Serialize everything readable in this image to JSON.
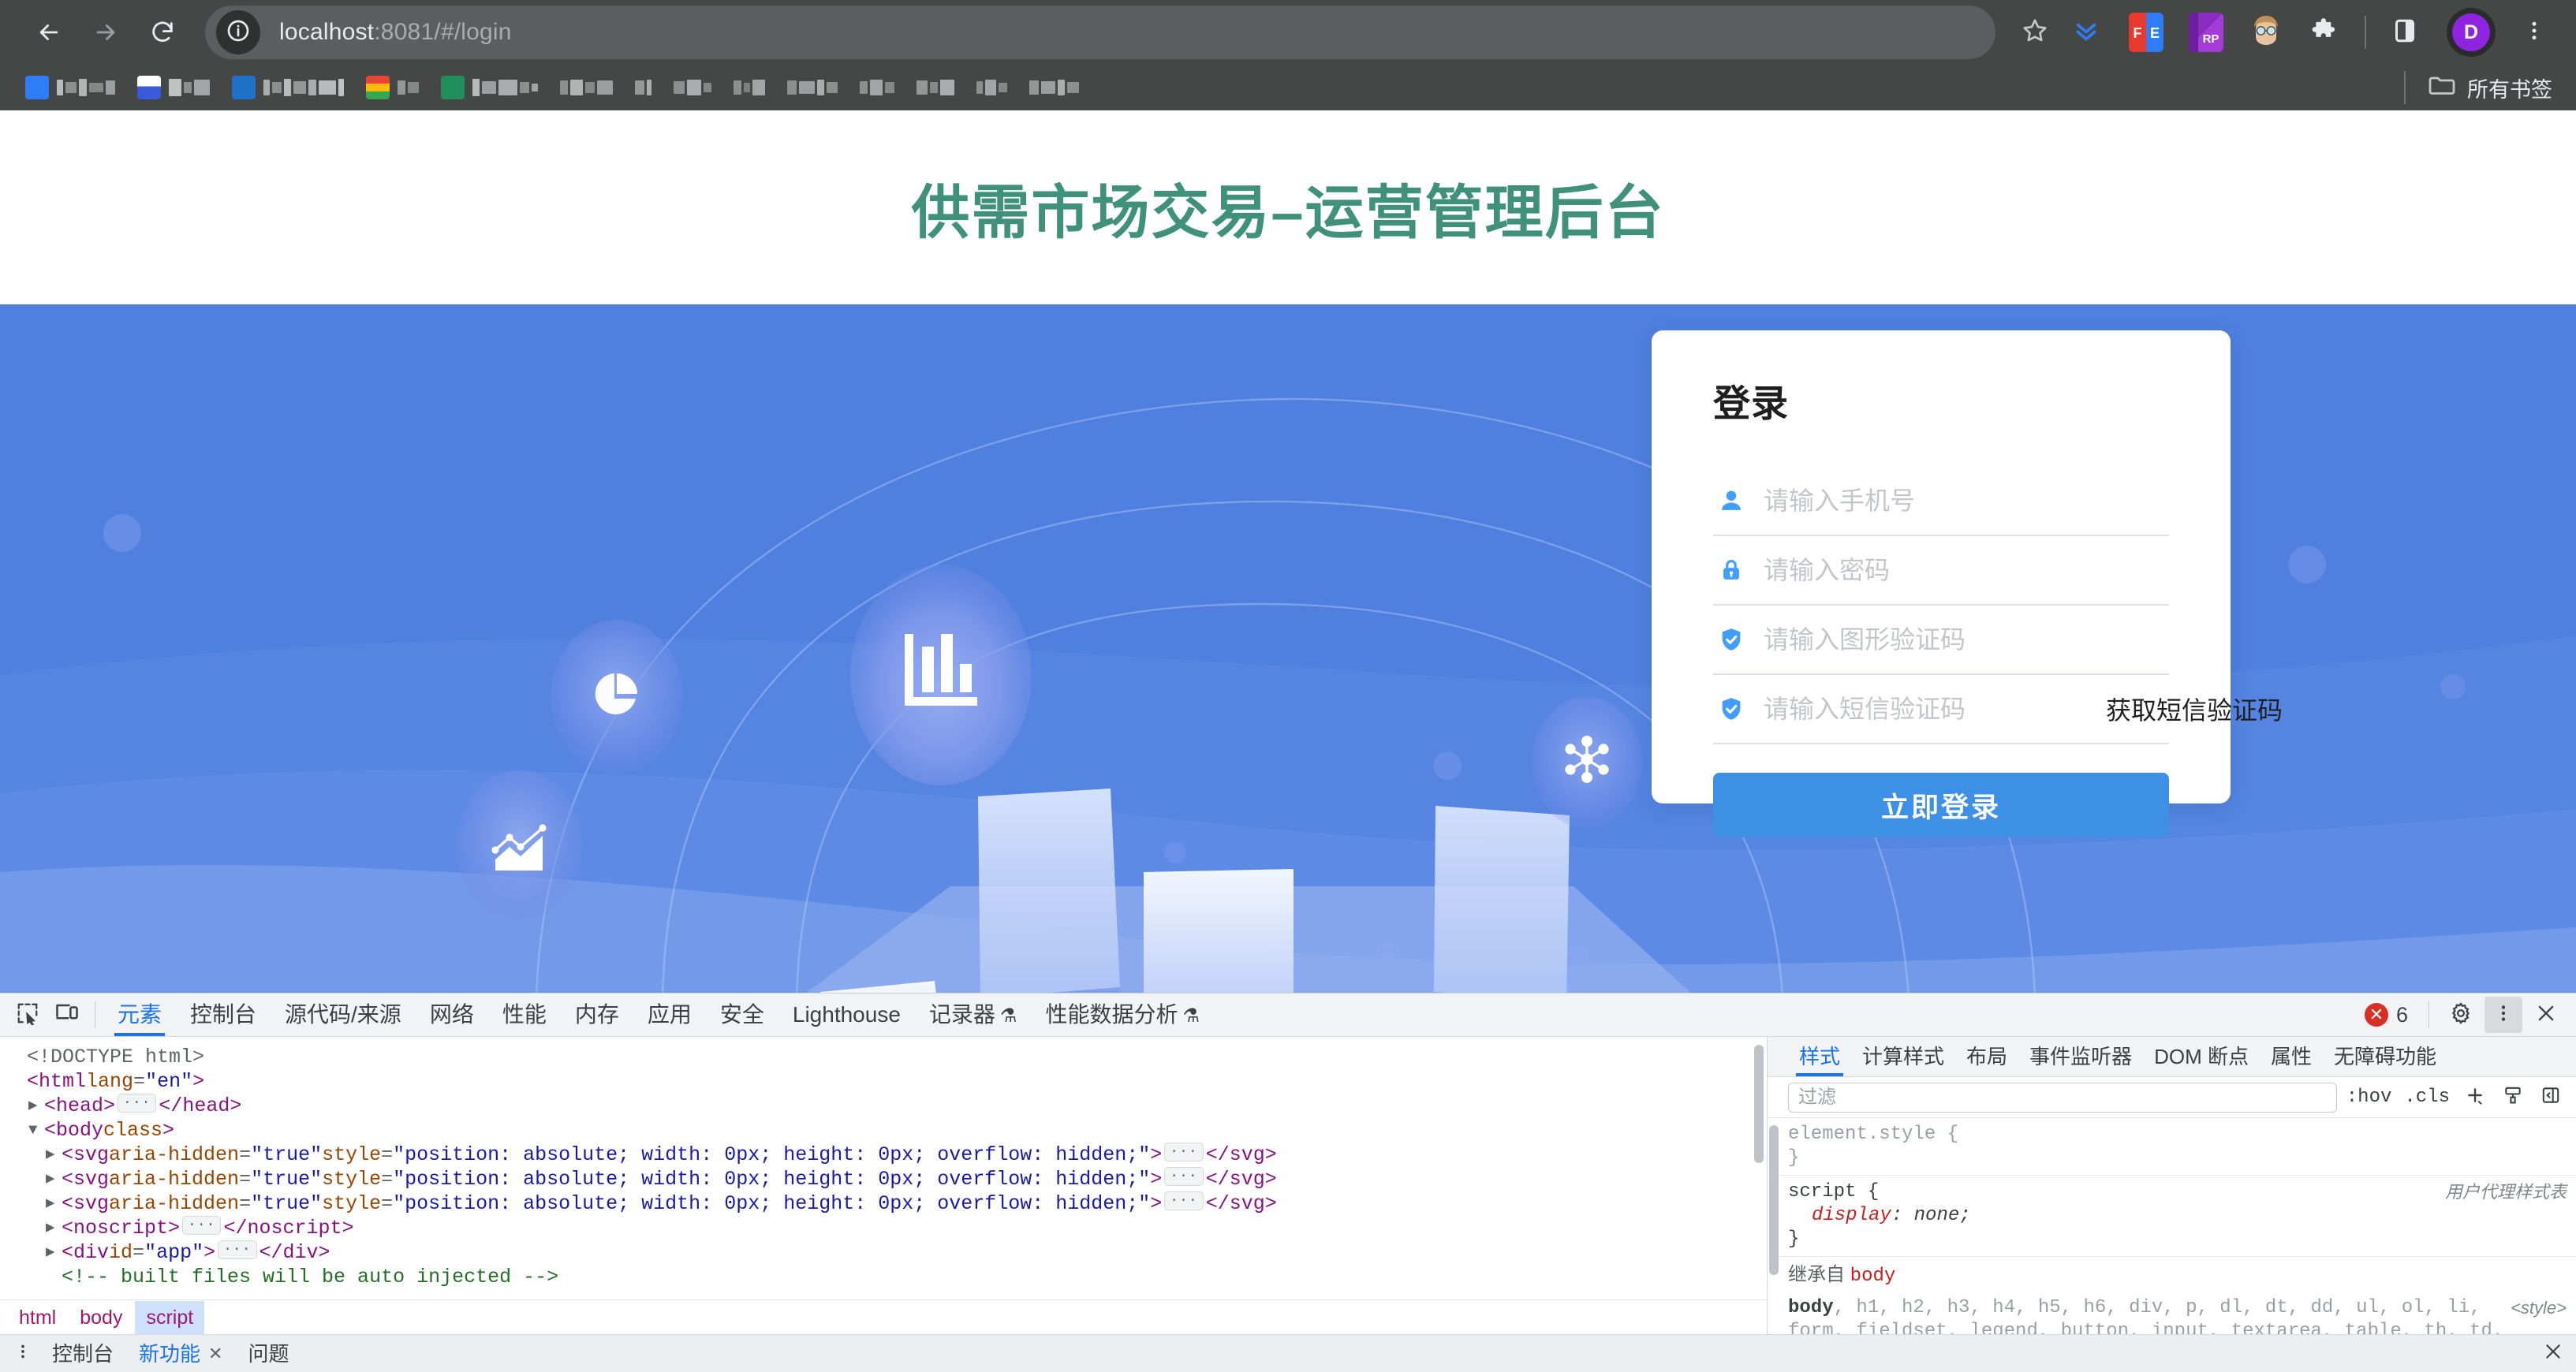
{
  "browser": {
    "url_main": "localhost",
    "url_rest": ":8081/#/login",
    "back_icon": "arrow-left-icon",
    "forward_icon": "arrow-right-icon",
    "reload_icon": "reload-icon",
    "site_info_icon": "info-circle-icon",
    "bookmark_star_icon": "star-icon",
    "downloads_icon": "downloads-icon",
    "extension_fe": "FE",
    "extension_rp": "RP",
    "profile_initial": "D",
    "menu_icon": "kebab-menu-icon",
    "all_bookmarks_label": "所有书签",
    "bookmarks_folder_icon": "folder-icon"
  },
  "page": {
    "title": "供需市场交易–运营管理后台",
    "title_color": "#3f9279",
    "hero_color": "#4f7fdf",
    "illustration_icons": [
      "pie-chart-icon",
      "bar-chart-icon",
      "network-hub-icon",
      "line-chart-icon"
    ]
  },
  "login": {
    "heading": "登录",
    "fields": [
      {
        "icon": "user-icon",
        "placeholder": "请输入手机号",
        "value": ""
      },
      {
        "icon": "lock-icon",
        "placeholder": "请输入密码",
        "value": ""
      },
      {
        "icon": "shield-check-icon",
        "placeholder": "请输入图形验证码",
        "value": ""
      },
      {
        "icon": "shield-check-icon",
        "placeholder": "请输入短信验证码",
        "value": ""
      }
    ],
    "sms_button": "获取短信验证码",
    "submit_button": "立即登录",
    "submit_color": "#3d90e3",
    "icon_color": "#409eff"
  },
  "devtools": {
    "inspect_icon": "inspect-element-icon",
    "device_icon": "device-toolbar-icon",
    "tabs": [
      {
        "label": "元素",
        "active": true
      },
      {
        "label": "控制台",
        "active": false
      },
      {
        "label": "源代码/来源",
        "active": false
      },
      {
        "label": "网络",
        "active": false
      },
      {
        "label": "性能",
        "active": false
      },
      {
        "label": "内存",
        "active": false
      },
      {
        "label": "应用",
        "active": false
      },
      {
        "label": "安全",
        "active": false
      },
      {
        "label": "Lighthouse",
        "active": false
      },
      {
        "label": "记录器",
        "active": false,
        "flask": "⚗"
      },
      {
        "label": "性能数据分析",
        "active": false,
        "flask": "⚗"
      }
    ],
    "error_count": "6",
    "error_icon": "error-circle-icon",
    "settings_icon": "gear-icon",
    "more_icon": "kebab-menu-icon",
    "close_icon": "close-icon",
    "dom": [
      {
        "indent": 0,
        "tri": "none",
        "parts": [
          {
            "t": "<!DOCTYPE html>",
            "c": "dt-gray"
          }
        ]
      },
      {
        "indent": 0,
        "tri": "none",
        "parts": [
          {
            "t": "<",
            "c": "tg"
          },
          {
            "t": "html",
            "c": "tg"
          },
          {
            "t": " lang",
            "c": "at"
          },
          {
            "t": "=",
            "c": "dt-gray"
          },
          {
            "t": "\"en\"",
            "c": "av"
          },
          {
            "t": ">",
            "c": "tg"
          }
        ]
      },
      {
        "indent": 1,
        "tri": "closed",
        "parts": [
          {
            "t": "<head>",
            "c": "tg"
          },
          {
            "t": "…",
            "c": "ellipsis"
          },
          {
            "t": "</head>",
            "c": "tg"
          }
        ]
      },
      {
        "indent": 1,
        "tri": "open",
        "parts": [
          {
            "t": "<",
            "c": "tg"
          },
          {
            "t": "body",
            "c": "tg"
          },
          {
            "t": " class",
            "c": "at"
          },
          {
            "t": ">",
            "c": "tg"
          }
        ]
      },
      {
        "indent": 2,
        "tri": "closed",
        "parts": [
          {
            "t": "<",
            "c": "tg"
          },
          {
            "t": "svg",
            "c": "tg"
          },
          {
            "t": " aria-hidden",
            "c": "at"
          },
          {
            "t": "=",
            "c": "dt-gray"
          },
          {
            "t": "\"true\"",
            "c": "av"
          },
          {
            "t": " style",
            "c": "at"
          },
          {
            "t": "=",
            "c": "dt-gray"
          },
          {
            "t": "\"position: absolute; width: 0px; height: 0px; overflow: hidden;\"",
            "c": "av"
          },
          {
            "t": ">",
            "c": "tg"
          },
          {
            "t": "…",
            "c": "ellipsis"
          },
          {
            "t": "</svg>",
            "c": "tg"
          }
        ]
      },
      {
        "indent": 2,
        "tri": "closed",
        "parts": [
          {
            "t": "<",
            "c": "tg"
          },
          {
            "t": "svg",
            "c": "tg"
          },
          {
            "t": " aria-hidden",
            "c": "at"
          },
          {
            "t": "=",
            "c": "dt-gray"
          },
          {
            "t": "\"true\"",
            "c": "av"
          },
          {
            "t": " style",
            "c": "at"
          },
          {
            "t": "=",
            "c": "dt-gray"
          },
          {
            "t": "\"position: absolute; width: 0px; height: 0px; overflow: hidden;\"",
            "c": "av"
          },
          {
            "t": ">",
            "c": "tg"
          },
          {
            "t": "…",
            "c": "ellipsis"
          },
          {
            "t": "</svg>",
            "c": "tg"
          }
        ]
      },
      {
        "indent": 2,
        "tri": "closed",
        "parts": [
          {
            "t": "<",
            "c": "tg"
          },
          {
            "t": "svg",
            "c": "tg"
          },
          {
            "t": " aria-hidden",
            "c": "at"
          },
          {
            "t": "=",
            "c": "dt-gray"
          },
          {
            "t": "\"true\"",
            "c": "av"
          },
          {
            "t": " style",
            "c": "at"
          },
          {
            "t": "=",
            "c": "dt-gray"
          },
          {
            "t": "\"position: absolute; width: 0px; height: 0px; overflow: hidden;\"",
            "c": "av"
          },
          {
            "t": ">",
            "c": "tg"
          },
          {
            "t": "…",
            "c": "ellipsis"
          },
          {
            "t": "</svg>",
            "c": "tg"
          }
        ]
      },
      {
        "indent": 2,
        "tri": "closed",
        "parts": [
          {
            "t": "<noscript>",
            "c": "tg"
          },
          {
            "t": "…",
            "c": "ellipsis"
          },
          {
            "t": "</noscript>",
            "c": "tg"
          }
        ]
      },
      {
        "indent": 2,
        "tri": "closed",
        "parts": [
          {
            "t": "<",
            "c": "tg"
          },
          {
            "t": "div",
            "c": "tg"
          },
          {
            "t": " id",
            "c": "at"
          },
          {
            "t": "=",
            "c": "dt-gray"
          },
          {
            "t": "\"app\"",
            "c": "av"
          },
          {
            "t": ">",
            "c": "tg"
          },
          {
            "t": "…",
            "c": "ellipsis"
          },
          {
            "t": "</div>",
            "c": "tg"
          }
        ]
      },
      {
        "indent": 2,
        "tri": "none",
        "parts": [
          {
            "t": "<!-- built files will be auto injected -->",
            "c": "cm"
          }
        ]
      }
    ],
    "breadcrumbs": [
      {
        "label": "html",
        "active": false
      },
      {
        "label": "body",
        "active": false
      },
      {
        "label": "script",
        "active": true
      }
    ],
    "styles": {
      "tabs": [
        {
          "label": "样式",
          "active": true
        },
        {
          "label": "计算样式",
          "active": false
        },
        {
          "label": "布局",
          "active": false
        },
        {
          "label": "事件监听器",
          "active": false
        },
        {
          "label": "DOM 断点",
          "active": false
        },
        {
          "label": "属性",
          "active": false
        },
        {
          "label": "无障碍功能",
          "active": false
        }
      ],
      "filter_placeholder": "过滤",
      "filter_value": "",
      "hov_label": ":hov",
      "cls_label": ".cls",
      "add_icon": "plus-icon",
      "pen_icon": "style-pen-icon",
      "sidebar_icon": "toggle-sidebar-icon",
      "rules": [
        {
          "selector": "element.style {",
          "close": "}",
          "origin": "",
          "decls": []
        },
        {
          "selector": "script {",
          "close": "}",
          "origin": "用户代理样式表",
          "decls": [
            {
              "prop": "display",
              "value": "none;"
            }
          ]
        }
      ],
      "inherit_label": "继承自",
      "inherit_from": "body",
      "inherited_rule_bold": "body",
      "inherited_rule_rest": ", h1, h2, h3, h4, h5, h6, div, p, dl, dt, dd, ul, ol, li,",
      "inherited_rule_line2": "form, fieldset, legend, button, input, textarea, table, th, td,",
      "inherited_origin": "<style>"
    },
    "drawer": {
      "kebab_icon": "kebab-menu-icon",
      "tabs": [
        {
          "label": "控制台",
          "active": false,
          "closable": false
        },
        {
          "label": "新功能",
          "active": true,
          "closable": true
        },
        {
          "label": "问题",
          "active": false,
          "closable": false
        }
      ],
      "close_icon": "close-icon"
    }
  }
}
